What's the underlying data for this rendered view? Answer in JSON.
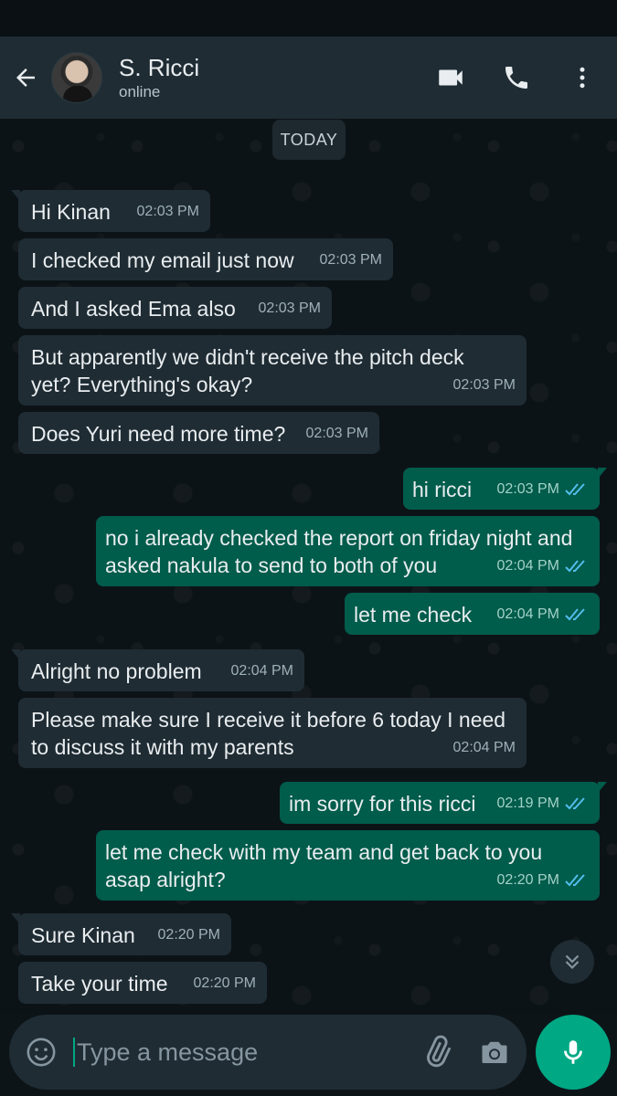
{
  "header": {
    "contact_name": "S. Ricci",
    "contact_status": "online"
  },
  "chat": {
    "date_chip": "TODAY",
    "messages": [
      {
        "direction": "incoming",
        "text": "Hi Kinan",
        "time": "02:03 PM"
      },
      {
        "direction": "incoming",
        "text": "I checked my email just now",
        "time": "02:03 PM"
      },
      {
        "direction": "incoming",
        "text": "And I asked Ema also",
        "time": "02:03 PM"
      },
      {
        "direction": "incoming",
        "text": "But apparently we didn't receive the pitch deck yet? Everything's okay?",
        "time": "02:03 PM"
      },
      {
        "direction": "incoming",
        "text": "Does Yuri need more time?",
        "time": "02:03 PM"
      },
      {
        "direction": "outgoing",
        "text": "hi ricci",
        "time": "02:03 PM",
        "status": "read"
      },
      {
        "direction": "outgoing",
        "text": "no i already checked the report on friday night and asked nakula to send to both of you",
        "time": "02:04 PM",
        "status": "read"
      },
      {
        "direction": "outgoing",
        "text": "let me check",
        "time": "02:04 PM",
        "status": "read"
      },
      {
        "direction": "incoming",
        "text": "Alright no problem",
        "time": "02:04 PM"
      },
      {
        "direction": "incoming",
        "text": "Please make sure I receive it before 6 today I need to discuss it with my parents",
        "time": "02:04 PM"
      },
      {
        "direction": "outgoing",
        "text": "im sorry for this ricci",
        "time": "02:19 PM",
        "status": "read"
      },
      {
        "direction": "outgoing",
        "text": "let me check with my team and get back to you asap alright?",
        "time": "02:20 PM",
        "status": "read"
      },
      {
        "direction": "incoming",
        "text": "Sure Kinan",
        "time": "02:20 PM"
      },
      {
        "direction": "incoming",
        "text": "Take your time",
        "time": "02:20 PM"
      }
    ]
  },
  "composer": {
    "placeholder": "Type a message"
  },
  "icons": {
    "back": "arrow-left-icon",
    "video": "video-camera-icon",
    "call": "phone-icon",
    "menu": "more-vertical-icon",
    "scroll": "chevron-double-down-icon",
    "emoji": "emoji-icon",
    "attach": "paperclip-icon",
    "camera": "camera-icon",
    "mic": "microphone-icon",
    "read_receipt": "double-check-icon"
  },
  "colors": {
    "header_bg": "#1f2c34",
    "incoming_bubble": "#1f2c34",
    "outgoing_bubble": "#005c4b",
    "accent": "#00a884",
    "read_tick": "#53bdeb"
  }
}
